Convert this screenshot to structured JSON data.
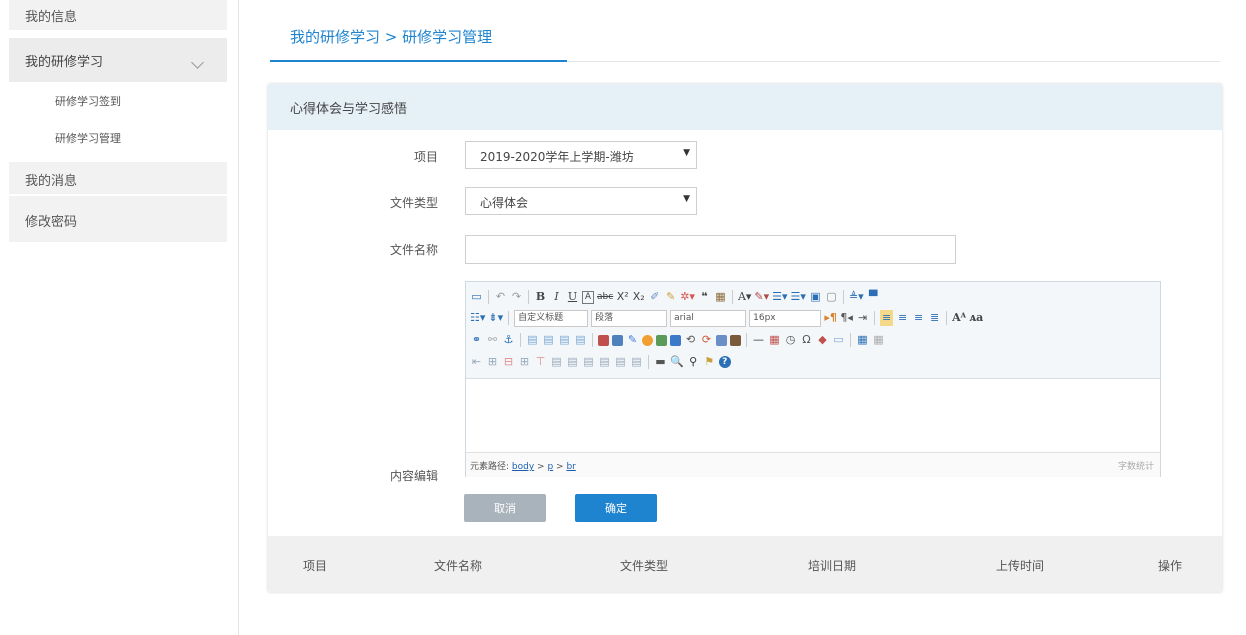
{
  "sidebar": {
    "top_item": "我的信息",
    "open_item": "我的研修学习",
    "sub_items": [
      "研修学习签到",
      "研修学习管理"
    ],
    "messages": "我的消息",
    "password": "修改密码"
  },
  "header": {
    "breadcrumb": "我的研修学习 > 研修学习管理"
  },
  "panel": {
    "title": "心得体会与学习感悟",
    "form": {
      "project_label": "项目",
      "project_value": "2019-2020学年上学期-潍坊",
      "file_type_label": "文件类型",
      "file_type_value": "心得体会",
      "file_name_label": "文件名称",
      "file_name_value": "",
      "content_label": "内容编辑"
    },
    "editor": {
      "dropdowns": {
        "heading": "自定义标题",
        "paragraph": "段落",
        "font": "arial",
        "size": "16px"
      },
      "status_prefix": "元素路径:",
      "status_path": [
        "body",
        "p",
        "br"
      ],
      "word_count": "字数统计"
    },
    "buttons": {
      "cancel": "取消",
      "ok": "确定"
    },
    "table_headers": [
      "项目",
      "文件名称",
      "文件类型",
      "培训日期",
      "上传时间",
      "操作"
    ]
  },
  "colors": {
    "accent": "#1f84cf",
    "panel_header": "#e6f0f7",
    "cancel_button": "#a9b3bb"
  }
}
